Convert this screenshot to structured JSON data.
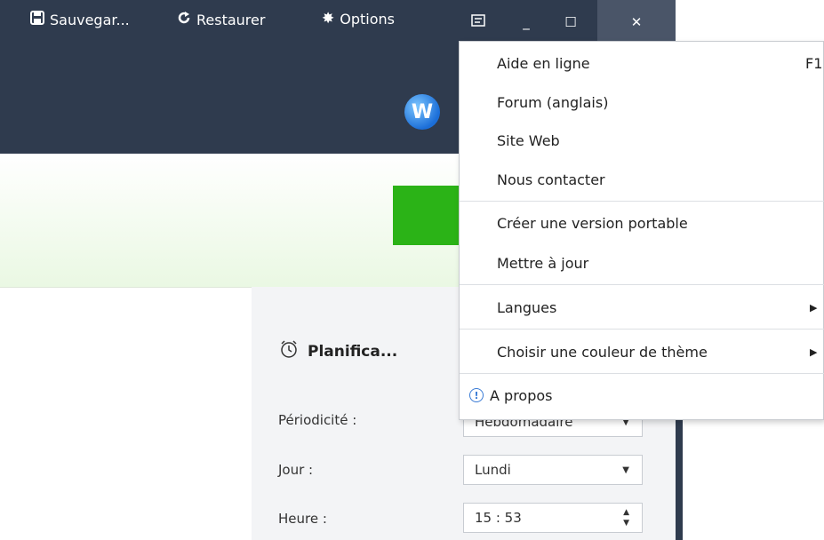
{
  "toolbar": {
    "save_label": "Sauvegar...",
    "restore_label": "Restaurer",
    "options_label": "Options",
    "save_icon": "save-icon",
    "restore_icon": "restore-icon",
    "options_icon": "gear-icon"
  },
  "window_controls": {
    "menu_icon": "menu-icon",
    "minimize": "_",
    "maximize": "☐",
    "close": "✕"
  },
  "logo": {
    "letter": "W"
  },
  "schedule": {
    "title": "Planifica...",
    "periodicity_label": "Périodicité :",
    "periodicity_value": "Hebdomadaire",
    "day_label": "Jour :",
    "day_value": "Lundi",
    "time_label": "Heure :",
    "time_value": "15 : 53"
  },
  "help_menu": {
    "items": [
      {
        "label": "Aide en ligne",
        "shortcut": "F1"
      },
      {
        "label": "Forum (anglais)"
      },
      {
        "label": "Site Web"
      },
      {
        "label": "Nous contacter"
      },
      {
        "label": "Créer une version portable"
      },
      {
        "label": "Mettre à jour"
      },
      {
        "label": "Langues"
      },
      {
        "label": "Choisir une couleur de thème"
      },
      {
        "label": "A propos"
      }
    ]
  },
  "colors": {
    "title_bar": "#2f3b4e",
    "accent_green": "#2bb317",
    "logo_blue": "#1b6ed8"
  }
}
